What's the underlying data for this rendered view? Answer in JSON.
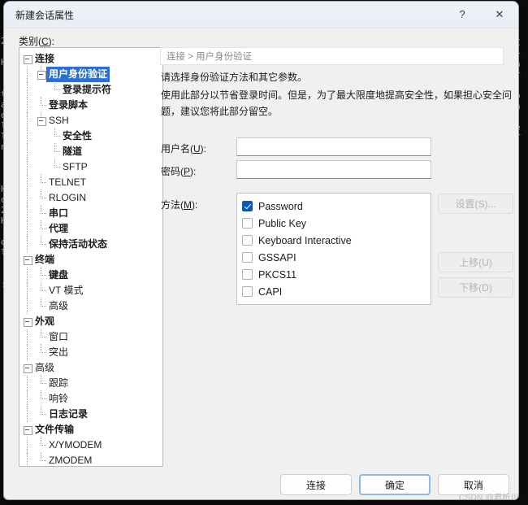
{
  "window": {
    "title": "新建会话属性",
    "help_label": "?",
    "close_label": "✕"
  },
  "category": {
    "label": "类别(C):"
  },
  "tree": {
    "nodes": [
      {
        "label": "连接",
        "depth": 0,
        "expandable": true,
        "selected": false,
        "bold": true
      },
      {
        "label": "用户身份验证",
        "depth": 1,
        "expandable": true,
        "selected": true,
        "bold": true
      },
      {
        "label": "登录提示符",
        "depth": 2,
        "expandable": false,
        "selected": false,
        "bold": true
      },
      {
        "label": "登录脚本",
        "depth": 1,
        "expandable": false,
        "selected": false,
        "bold": true
      },
      {
        "label": "SSH",
        "depth": 1,
        "expandable": true,
        "selected": false,
        "bold": false
      },
      {
        "label": "安全性",
        "depth": 2,
        "expandable": false,
        "selected": false,
        "bold": true
      },
      {
        "label": "隧道",
        "depth": 2,
        "expandable": false,
        "selected": false,
        "bold": true
      },
      {
        "label": "SFTP",
        "depth": 2,
        "expandable": false,
        "selected": false,
        "bold": false
      },
      {
        "label": "TELNET",
        "depth": 1,
        "expandable": false,
        "selected": false,
        "bold": false
      },
      {
        "label": "RLOGIN",
        "depth": 1,
        "expandable": false,
        "selected": false,
        "bold": false
      },
      {
        "label": "串口",
        "depth": 1,
        "expandable": false,
        "selected": false,
        "bold": true
      },
      {
        "label": "代理",
        "depth": 1,
        "expandable": false,
        "selected": false,
        "bold": true
      },
      {
        "label": "保持活动状态",
        "depth": 1,
        "expandable": false,
        "selected": false,
        "bold": true
      },
      {
        "label": "终端",
        "depth": 0,
        "expandable": true,
        "selected": false,
        "bold": true
      },
      {
        "label": "键盘",
        "depth": 1,
        "expandable": false,
        "selected": false,
        "bold": true
      },
      {
        "label": "VT 模式",
        "depth": 1,
        "expandable": false,
        "selected": false,
        "bold": false
      },
      {
        "label": "高级",
        "depth": 1,
        "expandable": false,
        "selected": false,
        "bold": false
      },
      {
        "label": "外观",
        "depth": 0,
        "expandable": true,
        "selected": false,
        "bold": true
      },
      {
        "label": "窗口",
        "depth": 1,
        "expandable": false,
        "selected": false,
        "bold": false
      },
      {
        "label": "突出",
        "depth": 1,
        "expandable": false,
        "selected": false,
        "bold": false
      },
      {
        "label": "高级",
        "depth": 0,
        "expandable": true,
        "selected": false,
        "bold": false
      },
      {
        "label": "跟踪",
        "depth": 1,
        "expandable": false,
        "selected": false,
        "bold": false
      },
      {
        "label": "响铃",
        "depth": 1,
        "expandable": false,
        "selected": false,
        "bold": false
      },
      {
        "label": "日志记录",
        "depth": 1,
        "expandable": false,
        "selected": false,
        "bold": true
      },
      {
        "label": "文件传输",
        "depth": 0,
        "expandable": true,
        "selected": false,
        "bold": true
      },
      {
        "label": "X/YMODEM",
        "depth": 1,
        "expandable": false,
        "selected": false,
        "bold": false
      },
      {
        "label": "ZMODEM",
        "depth": 1,
        "expandable": false,
        "selected": false,
        "bold": false
      }
    ]
  },
  "pane": {
    "breadcrumb": "连接 > 用户身份验证",
    "description_1": "请选择身份验证方法和其它参数。",
    "description_2": "使用此部分以节省登录时间。但是，为了最大限度地提高安全性，如果担心安全问题，建议您将此部分留空。",
    "username": {
      "label": "用户名(U):",
      "value": "",
      "placeholder": ""
    },
    "password": {
      "label": "密码(P):",
      "value": "",
      "placeholder": ""
    },
    "method": {
      "label": "方法(M):",
      "items": [
        {
          "label": "Password",
          "checked": true
        },
        {
          "label": "Public Key",
          "checked": false
        },
        {
          "label": "Keyboard Interactive",
          "checked": false
        },
        {
          "label": "GSSAPI",
          "checked": false
        },
        {
          "label": "PKCS11",
          "checked": false
        },
        {
          "label": "CAPI",
          "checked": false
        }
      ]
    },
    "side_buttons": {
      "settings": "设置(S)...",
      "move_up": "上移(U)",
      "move_down": "下移(D)"
    }
  },
  "footer": {
    "connect": "连接",
    "ok": "确定",
    "cancel": "取消"
  },
  "watermark": "CSDN @君析川",
  "backdrop": {
    "left_column": "2\n\nH\n\n\nt\na\no\nl\nl\nn\n\n\n\nH\no\n2\nH\n\no\nl\n\n\n:",
    "right_column": "C\n+\na\nr\n \no\nh\n \ne\nT"
  },
  "colors": {
    "accent": "#2a6fd4",
    "checkbox_checked": "#0b57b5",
    "focus_border": "#8fb8e4",
    "dialog_bg": "#f0f0f0",
    "terminal_bg": "#0c0c0c"
  }
}
